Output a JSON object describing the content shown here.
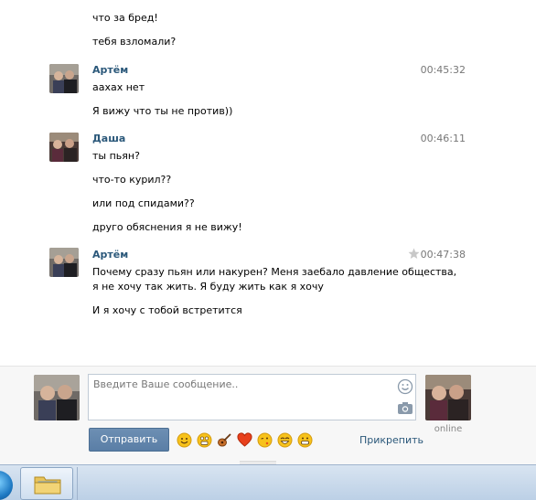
{
  "messages": [
    {
      "lines": [
        "что за бред!",
        "тебя взломали?"
      ]
    },
    {
      "author": "Артём",
      "time": "00:45:32",
      "lines": [
        "аахах нет",
        "Я вижу что ты не против))"
      ]
    },
    {
      "author": "Даша",
      "time": "00:46:11",
      "lines": [
        "ты пьян?",
        "что-то курил??",
        "или под спидами??",
        "друго обяснения я не вижу!"
      ]
    },
    {
      "author": "Артём",
      "time": "00:47:38",
      "lines": [
        "Почему сразу пьян или накурен? Меня заебало давление общества,",
        "я не хочу так жить. Я буду жить как я хочу",
        "И я хочу с тобой встретится"
      ]
    }
  ],
  "composer": {
    "placeholder": "Введите Ваше сообщение..",
    "send_label": "Отправить",
    "attach_label": "Прикрепить",
    "peer_status": "online",
    "emoji": [
      "smile-emoji",
      "scared-emoji",
      "guitar-emoji",
      "heart-emoji",
      "kiss-emoji",
      "laugh-emoji",
      "grin-emoji"
    ]
  },
  "colors": {
    "author": "#2b587a",
    "send_button": "#5a7ea6",
    "taskbar": "#c9d9ea"
  }
}
